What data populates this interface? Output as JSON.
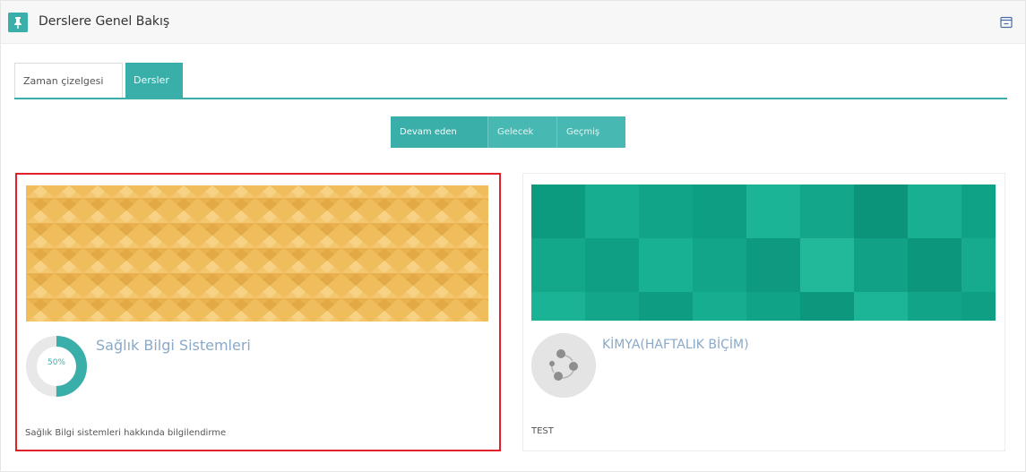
{
  "block": {
    "title": "Derslere Genel Bakış"
  },
  "tabs": [
    {
      "label": "Zaman çizelgesi",
      "active": false
    },
    {
      "label": "Dersler",
      "active": true
    }
  ],
  "filters": [
    {
      "label": "Devam eden",
      "active": true
    },
    {
      "label": "Gelecek",
      "active": false
    },
    {
      "label": "Geçmiş",
      "active": false
    }
  ],
  "courses": [
    {
      "title": "Sağlık Bilgi Sistemleri",
      "progress_label": "50%",
      "progress": 0.5,
      "summary": "Sağlık Bilgi sistemleri hakkında bilgilendirme",
      "image_color": "#f0bd5c",
      "selected": true
    },
    {
      "title": "KİMYA(HAFTALIK BİÇİM)",
      "summary": "TEST",
      "image_color": "#11a58a",
      "selected": false
    }
  ],
  "colors": {
    "accent": "#3aafa9",
    "title_blue": "#8aa9c7",
    "selection_red": "#e0202a"
  },
  "icons": {
    "block_icon": "pin-icon",
    "collapse_icon": "collapse-icon",
    "course_icon": "share-nodes-icon"
  }
}
